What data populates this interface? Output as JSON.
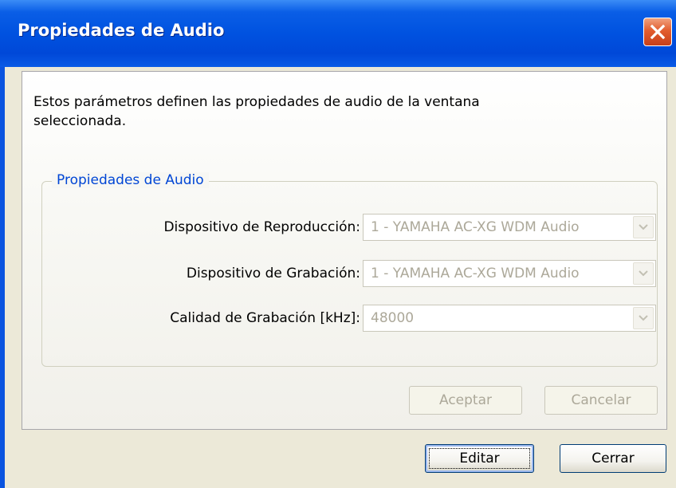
{
  "window": {
    "title": "Propiedades de Audio"
  },
  "panel": {
    "description": "Estos parámetros definen las propiedades de audio de la ventana seleccionada.",
    "group": {
      "label": "Propiedades de Audio",
      "fields": [
        {
          "label": "Dispositivo de Reproducción:",
          "value": "1 - YAMAHA AC-XG WDM Audio",
          "enabled": false
        },
        {
          "label": "Dispositivo de Grabación:",
          "value": "1 - YAMAHA AC-XG WDM Audio",
          "enabled": false
        },
        {
          "label": "Calidad de Grabación [kHz]:",
          "value": "48000",
          "enabled": false
        }
      ]
    },
    "buttons": {
      "accept": "Aceptar",
      "cancel": "Cancelar"
    }
  },
  "footer": {
    "edit": "Editar",
    "close": "Cerrar"
  },
  "icons": {
    "close": "close-x-icon",
    "dropdown": "chevron-down-icon"
  },
  "colors": {
    "titlebar": "#0052e0",
    "group_label": "#0046d5",
    "disabled_text": "#aca899",
    "close_button": "#e25d2f"
  }
}
